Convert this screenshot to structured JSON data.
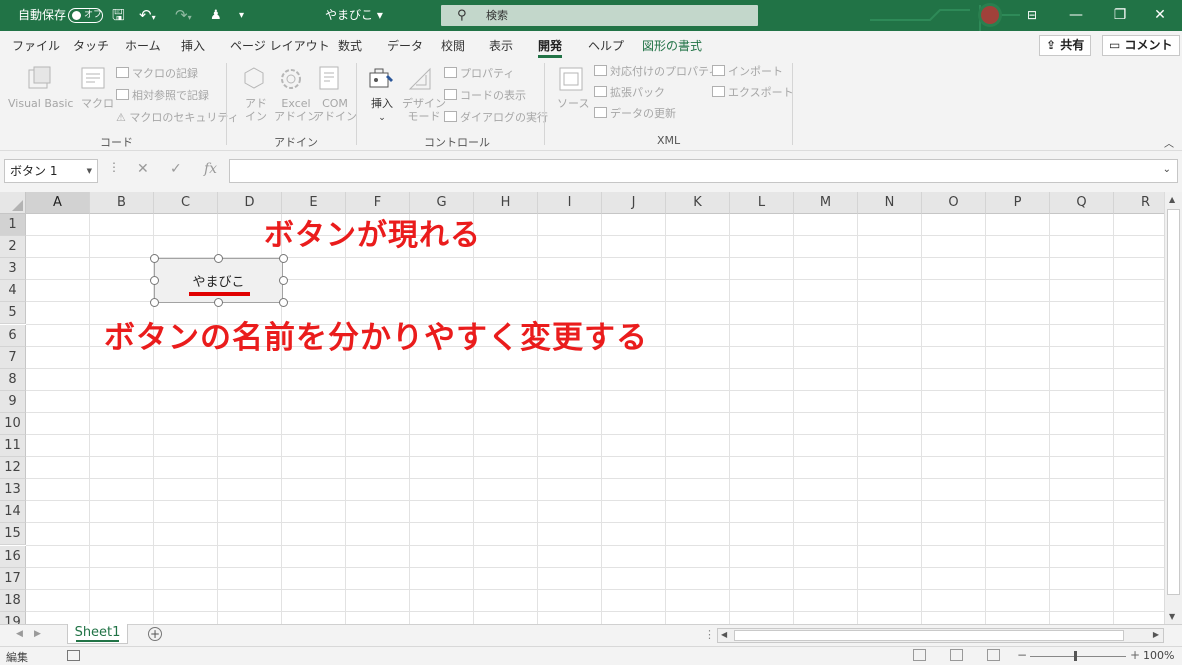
{
  "titlebar": {
    "autosave_label": "自動保存",
    "autosave_state": "オフ",
    "doc_title": "やまびこ ▾",
    "search_placeholder": "検索",
    "accent": "#217346"
  },
  "tabs": [
    "ファイル",
    "タッチ",
    "ホーム",
    "挿入",
    "ページ レイアウト",
    "数式",
    "データ",
    "校閲",
    "表示",
    "開発",
    "ヘルプ",
    "図形の書式"
  ],
  "active_tab": "開発",
  "share_label": "共有",
  "comment_label": "コメント",
  "ribbon": {
    "code": {
      "visual_basic": "Visual Basic",
      "macro": "マクロ",
      "record": "マクロの記録",
      "relative": "相対参照で記録",
      "security": "マクロのセキュリティ",
      "group": "コード"
    },
    "addins": {
      "addin_l1": "アド",
      "addin_l2": "イン",
      "excel_l1": "Excel",
      "excel_l2": "アドイン",
      "com_l1": "COM",
      "com_l2": "アドイン",
      "group": "アドイン"
    },
    "controls": {
      "insert": "挿入",
      "design_l1": "デザイン",
      "design_l2": "モード",
      "properties": "プロパティ",
      "view_code": "コードの表示",
      "dialog": "ダイアログの実行",
      "group": "コントロール"
    },
    "xml": {
      "source": "ソース",
      "map_props": "対応付けのプロパティ",
      "expansion": "拡張パック",
      "refresh": "データの更新",
      "import": "インポート",
      "export": "エクスポート",
      "group": "XML"
    }
  },
  "namebox": "ボタン 1",
  "columns": [
    "A",
    "B",
    "C",
    "D",
    "E",
    "F",
    "G",
    "H",
    "I",
    "J",
    "K",
    "L",
    "M",
    "N",
    "O",
    "P",
    "Q",
    "R"
  ],
  "rows": [
    "1",
    "2",
    "3",
    "4",
    "5",
    "6",
    "7",
    "8",
    "9",
    "10",
    "11",
    "12",
    "13",
    "14",
    "15",
    "16",
    "17",
    "18",
    "19"
  ],
  "button_label": "やまびこ",
  "annotations": {
    "a1": "ボタンが現れる",
    "a2": "ボタンの名前を分かりやすく変更する",
    "color": "#ea1c1c"
  },
  "sheet_tab": "Sheet1",
  "status": {
    "mode": "編集",
    "zoom": "100%"
  }
}
